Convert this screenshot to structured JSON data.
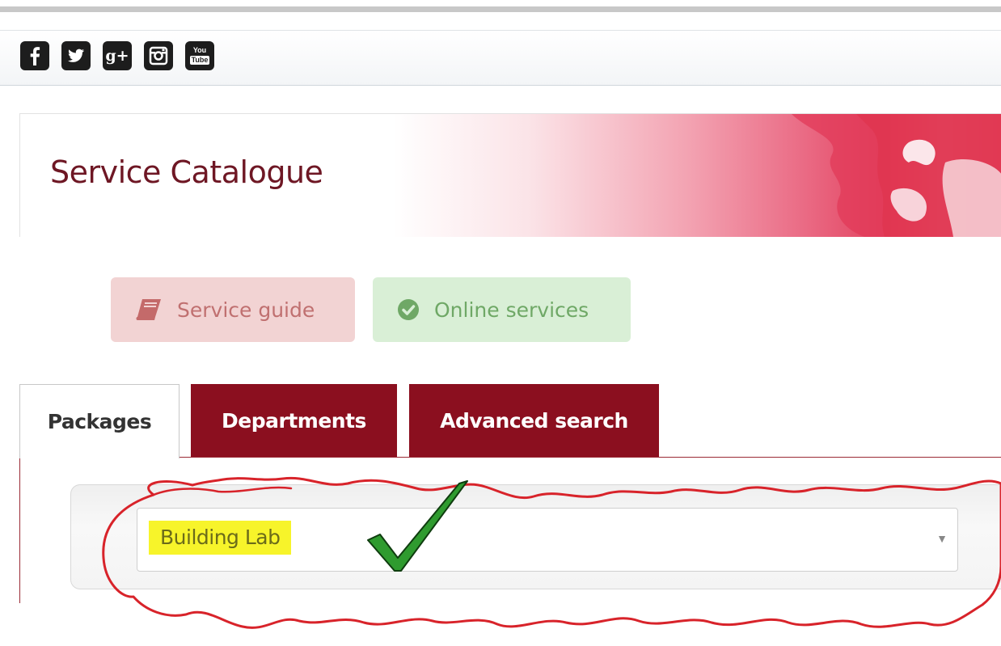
{
  "social": {
    "icons": [
      "facebook-icon",
      "twitter-icon",
      "google-plus-icon",
      "instagram-icon",
      "youtube-icon"
    ],
    "google_plus_text": "g+",
    "youtube_text_top": "You",
    "youtube_text_bottom": "Tube"
  },
  "banner": {
    "title": "Service Catalogue"
  },
  "quick_links": {
    "service_guide": "Service guide",
    "online_services": "Online services"
  },
  "tabs": [
    {
      "label": "Packages",
      "active": true
    },
    {
      "label": "Departments",
      "active": false
    },
    {
      "label": "Advanced search",
      "active": false
    }
  ],
  "package_select": {
    "selected": "Building Lab",
    "arrow": "▼"
  },
  "colors": {
    "brand": "#8b0f1f",
    "title": "#6e1724",
    "highlight": "#f7f42a",
    "annotation_red": "#d8232a",
    "checkmark_green": "#2f9b2f"
  }
}
